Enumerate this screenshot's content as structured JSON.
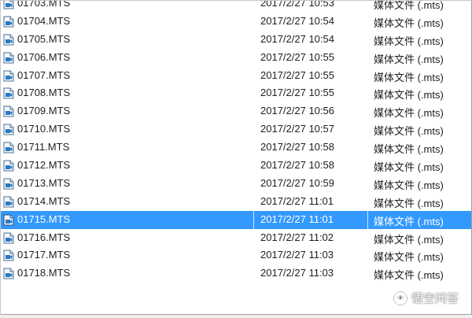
{
  "files": [
    {
      "name": "01703.MTS",
      "date": "2017/2/27 10:53",
      "type": "媒体文件 (.mts)",
      "icon": "mts-file-icon"
    },
    {
      "name": "01704.MTS",
      "date": "2017/2/27 10:54",
      "type": "媒体文件 (.mts)",
      "icon": "mts-file-icon"
    },
    {
      "name": "01705.MTS",
      "date": "2017/2/27 10:54",
      "type": "媒体文件 (.mts)",
      "icon": "mts-file-icon"
    },
    {
      "name": "01706.MTS",
      "date": "2017/2/27 10:55",
      "type": "媒体文件 (.mts)",
      "icon": "mts-file-icon"
    },
    {
      "name": "01707.MTS",
      "date": "2017/2/27 10:55",
      "type": "媒体文件 (.mts)",
      "icon": "mts-file-icon"
    },
    {
      "name": "01708.MTS",
      "date": "2017/2/27 10:55",
      "type": "媒体文件 (.mts)",
      "icon": "mts-file-icon"
    },
    {
      "name": "01709.MTS",
      "date": "2017/2/27 10:56",
      "type": "媒体文件 (.mts)",
      "icon": "mts-file-icon"
    },
    {
      "name": "01710.MTS",
      "date": "2017/2/27 10:57",
      "type": "媒体文件 (.mts)",
      "icon": "mts-file-icon"
    },
    {
      "name": "01711.MTS",
      "date": "2017/2/27 10:58",
      "type": "媒体文件 (.mts)",
      "icon": "mts-file-icon"
    },
    {
      "name": "01712.MTS",
      "date": "2017/2/27 10:58",
      "type": "媒体文件 (.mts)",
      "icon": "mts-file-icon"
    },
    {
      "name": "01713.MTS",
      "date": "2017/2/27 10:59",
      "type": "媒体文件 (.mts)",
      "icon": "mts-file-icon"
    },
    {
      "name": "01714.MTS",
      "date": "2017/2/27 11:01",
      "type": "媒体文件 (.mts)",
      "icon": "mts-file-icon"
    },
    {
      "name": "01715.MTS",
      "date": "2017/2/27 11:01",
      "type": "媒体文件 (.mts)",
      "icon": "mts-file-icon",
      "selected": true
    },
    {
      "name": "01716.MTS",
      "date": "2017/2/27 11:02",
      "type": "媒体文件 (.mts)",
      "icon": "mts-file-icon"
    },
    {
      "name": "01717.MTS",
      "date": "2017/2/27 11:03",
      "type": "媒体文件 (.mts)",
      "icon": "mts-file-icon"
    },
    {
      "name": "01718.MTS",
      "date": "2017/2/27 11:03",
      "type": "媒体文件 (.mts)",
      "icon": "mts-file-icon"
    }
  ],
  "colors": {
    "selection_bg": "#3399ff",
    "selection_text": "#ffffff",
    "text": "#1e1e1e"
  },
  "watermark": {
    "text": "悟空问答",
    "icon": "wukong-logo-icon"
  }
}
